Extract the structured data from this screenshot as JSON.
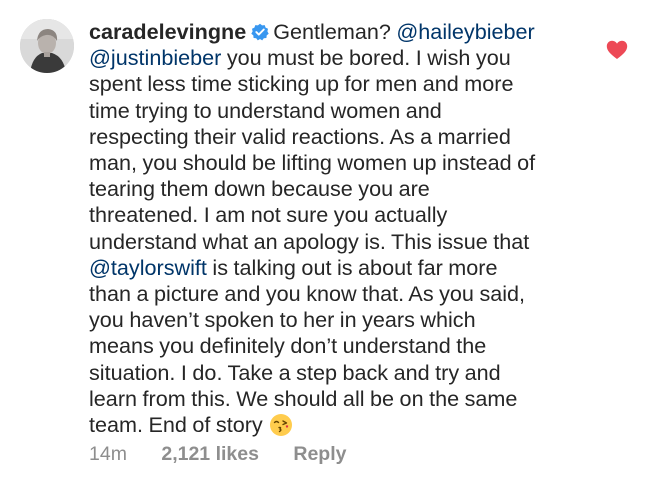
{
  "comment": {
    "username": "caradelevingne",
    "lines": [
      {
        "pre": "Gentleman? ",
        "mention": "@haileybieber",
        "post": ""
      },
      {
        "pre": "",
        "mention": "@justinbieber",
        "post": " you must be bored. I wish you"
      },
      {
        "pre": "spent less time sticking up for men and more",
        "mention": "",
        "post": ""
      },
      {
        "pre": "time trying to understand women and",
        "mention": "",
        "post": ""
      },
      {
        "pre": "respecting their valid reactions. As a married",
        "mention": "",
        "post": ""
      },
      {
        "pre": "man, you should be lifting women up instead of",
        "mention": "",
        "post": ""
      },
      {
        "pre": "tearing them down because you are",
        "mention": "",
        "post": ""
      },
      {
        "pre": "threatened. I am not sure you actually",
        "mention": "",
        "post": ""
      },
      {
        "pre": "understand what an apology is. This issue that",
        "mention": "",
        "post": ""
      },
      {
        "pre": "",
        "mention": "@taylorswift",
        "post": " is talking out is about far more"
      },
      {
        "pre": "than a picture and you know that. As you said,",
        "mention": "",
        "post": ""
      },
      {
        "pre": "you haven’t spoken to her in years which",
        "mention": "",
        "post": ""
      },
      {
        "pre": "means you definitely don’t understand the",
        "mention": "",
        "post": ""
      },
      {
        "pre": "situation. I do. Take a step back and try and",
        "mention": "",
        "post": ""
      },
      {
        "pre": "learn from this. We should all be on the same",
        "mention": "",
        "post": ""
      },
      {
        "pre": "team. End of story",
        "mention": "",
        "post": ""
      }
    ],
    "emoji": "face-throwing-kiss-icon"
  },
  "meta": {
    "time": "14m",
    "likes": "2,121 likes",
    "reply": "Reply"
  },
  "icons": {
    "verified": "verified-badge-icon",
    "like": "heart-icon"
  },
  "colors": {
    "text": "#262626",
    "mention": "#003569",
    "meta": "#8e8e8e",
    "verified": "#3897f0",
    "heart": "#ed4956"
  }
}
